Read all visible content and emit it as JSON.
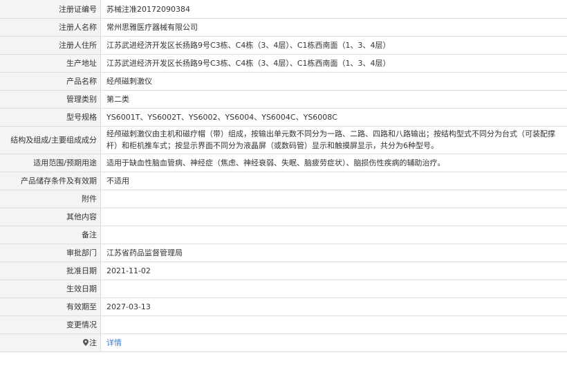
{
  "rows": [
    {
      "label": "注册证编号",
      "value": "苏械注准20172090384"
    },
    {
      "label": "注册人名称",
      "value": "常州思雅医疗器械有限公司"
    },
    {
      "label": "注册人住所",
      "value": "江苏武进经济开发区长扬路9号C3栋、C4栋（3、4层）、C1栋西南面（1、3、4层）"
    },
    {
      "label": "生产地址",
      "value": "江苏武进经济开发区长扬路9号C3栋、C4栋（3、4层）、C1栋西南面（1、3、4层）"
    },
    {
      "label": "产品名称",
      "value": "经颅磁刺激仪"
    },
    {
      "label": "管理类别",
      "value": "第二类"
    },
    {
      "label": "型号规格",
      "value": "YS6001T、YS6002T、YS6002、YS6004、YS6004C、YS6008C"
    },
    {
      "label": "结构及组成/主要组成成分",
      "value": "经颅磁刺激仪由主机和磁疗帽（带）组成，按输出单元数不同分为一路、二路、四路和八路输出；按结构型式不同分为台式（可装配撑杆）和柜机推车式；按显示界面不同分为液晶屏（或数码管）显示和触摸屏显示，共分为6种型号。"
    },
    {
      "label": "适用范围/预期用途",
      "value": "适用于缺血性脑血管病、神经症（焦虑、神经衰弱、失眠、脑疲劳症状）、脑损伤性疾病的辅助治疗。"
    },
    {
      "label": "产品储存条件及有效期",
      "value": "不适用"
    },
    {
      "label": "附件",
      "value": ""
    },
    {
      "label": "其他内容",
      "value": ""
    },
    {
      "label": "备注",
      "value": ""
    },
    {
      "label": "审批部门",
      "value": "江苏省药品监督管理局"
    },
    {
      "label": "批准日期",
      "value": "2021-11-02"
    },
    {
      "label": "生效日期",
      "value": ""
    },
    {
      "label": "有效期至",
      "value": "2027-03-13"
    },
    {
      "label": "变更情况",
      "value": ""
    },
    {
      "label": "注",
      "value": "详情",
      "icon": "map-pin-icon"
    }
  ]
}
